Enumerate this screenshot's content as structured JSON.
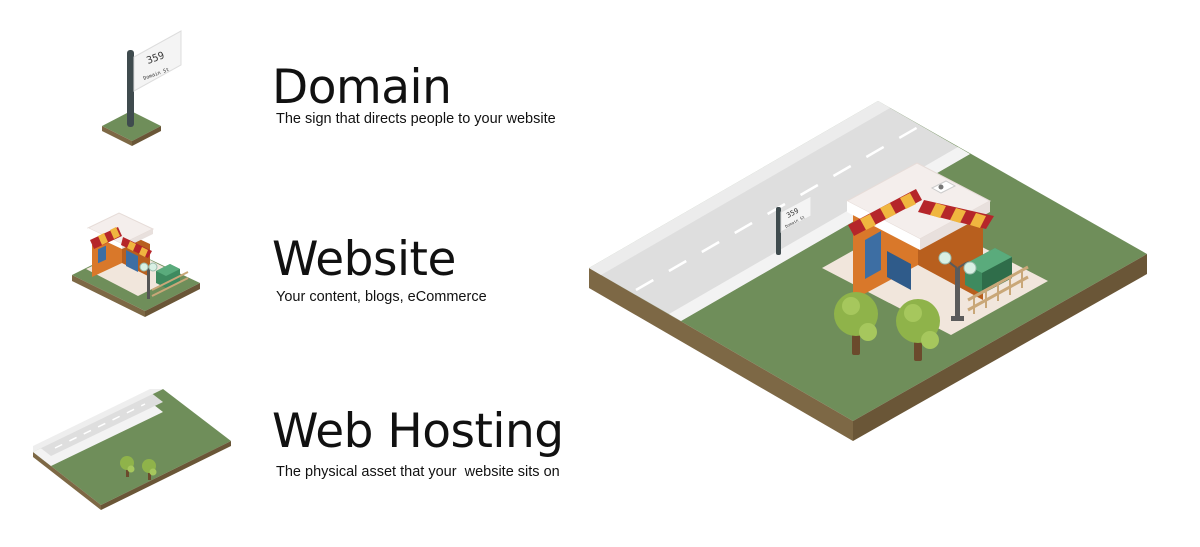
{
  "sign": {
    "number": "359",
    "street": "Domain St"
  },
  "items": [
    {
      "title": "Domain",
      "description": "The sign that directs people to your website"
    },
    {
      "title": "Website",
      "description": "Your content, blogs, eCommerce"
    },
    {
      "title": "Web Hosting",
      "description": "The physical asset that your  website sits on"
    }
  ],
  "colors": {
    "grass": "#6f8e5a",
    "soil": "#7d6845",
    "road": "#dedede",
    "roadEdge": "#f3f3f3",
    "walls": "#d9782a",
    "awningRed": "#b5262a",
    "awningYellow": "#f0b63f",
    "roof": "#f4eeec",
    "dumpster": "#3e8a5f",
    "tree": "#8fb34a"
  }
}
